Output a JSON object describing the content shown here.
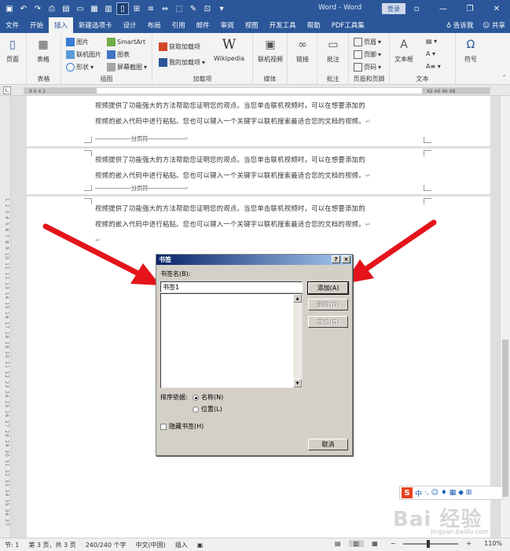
{
  "window": {
    "title": "Word - Word",
    "login_label": "登录",
    "minimize": "—",
    "restore": "❐",
    "close": "✕"
  },
  "quick_access": [
    "save-icon",
    "undo-icon",
    "redo-icon",
    "print-preview-icon",
    "open-icon",
    "new-icon",
    "image-icon",
    "layout-icon",
    "page-icon",
    "insert-icon",
    "list-icon",
    "spacing-icon",
    "select-icon",
    "draw-icon",
    "table-icon",
    "more-icon"
  ],
  "tabs": [
    {
      "label": "文件",
      "active": false
    },
    {
      "label": "开始",
      "active": false
    },
    {
      "label": "插入",
      "active": true
    },
    {
      "label": "新建选项卡",
      "active": false
    },
    {
      "label": "设计",
      "active": false
    },
    {
      "label": "布局",
      "active": false
    },
    {
      "label": "引用",
      "active": false
    },
    {
      "label": "邮件",
      "active": false
    },
    {
      "label": "审阅",
      "active": false
    },
    {
      "label": "视图",
      "active": false
    },
    {
      "label": "开发工具",
      "active": false
    },
    {
      "label": "帮助",
      "active": false
    },
    {
      "label": "PDF工具集",
      "active": false
    }
  ],
  "tab_right": {
    "tell_me": "告诉我",
    "share": "共享"
  },
  "ribbon": {
    "pages": {
      "label": "页面",
      "group": ""
    },
    "table": {
      "label": "表格",
      "group": "表格"
    },
    "illustrations": {
      "group": "插图",
      "picture": "图片",
      "online_picture": "联机图片",
      "shapes": "形状",
      "smartart": "SmartArt",
      "chart": "图表",
      "screenshot": "屏幕截图"
    },
    "addins": {
      "group": "加载项",
      "get": "获取加载项",
      "my": "我的加载项",
      "wikipedia": "Wikipedia"
    },
    "media": {
      "group": "媒体",
      "online_video": "联机视频"
    },
    "links": {
      "label": "链接"
    },
    "comments": {
      "group": "批注",
      "label": "批注"
    },
    "header_footer": {
      "group": "页眉和页脚",
      "header": "页眉",
      "footer": "页脚",
      "page_number": "页码"
    },
    "text": {
      "group": "文本",
      "textbox": "文本框"
    },
    "symbols": {
      "label": "符号"
    }
  },
  "ruler": {
    "left_numbers": "8   6   4   2",
    "right_numbers": "42  44  46  48",
    "vertical_numbers": "1  2  3  4  5  6  7  8  9  10  11  12  13  14  15  16  17  18  19  20  21  22  23  24  25  26  27  28  29  30  31  32  33  34  35  36  37"
  },
  "document": {
    "para_line1": "视频提供了功能强大的方法帮助您证明您的观点。当您单击联机视频时，可以在想要添加的",
    "para_line2": "视频的嵌入代码中进行粘贴。您也可以键入一个关键字以联机搜索最适合您的文档的视频。",
    "para_mark": "↵",
    "page_break": "-------------------分页符-------------------"
  },
  "dialog": {
    "title": "书签",
    "help": "?",
    "close": "×",
    "name_label": "书签名(B):",
    "name_value": "书签1",
    "add_button": "添加(A)",
    "delete_button": "删除(D)",
    "goto_button": "定位(G)",
    "sort_label": "排序依据:",
    "sort_name": "名称(N)",
    "sort_position": "位置(L)",
    "hidden_label": "隐藏书签(H)",
    "cancel_button": "取消"
  },
  "ime": {
    "logo": "S",
    "mode": "中",
    "icons": "·, ☺ ♦ ▦ ◆ ⊞"
  },
  "watermark": {
    "text": "Bai 经验",
    "sub": "jingyan.baidu.com"
  },
  "status": {
    "section": "节: 1",
    "page": "第 3 页，共 3 页",
    "words": "240/240 个字",
    "lang": "中文(中国)",
    "mode": "插入",
    "zoom": "110%"
  },
  "colors": {
    "word_blue": "#2b579a",
    "arrow_red": "#e5141b"
  }
}
